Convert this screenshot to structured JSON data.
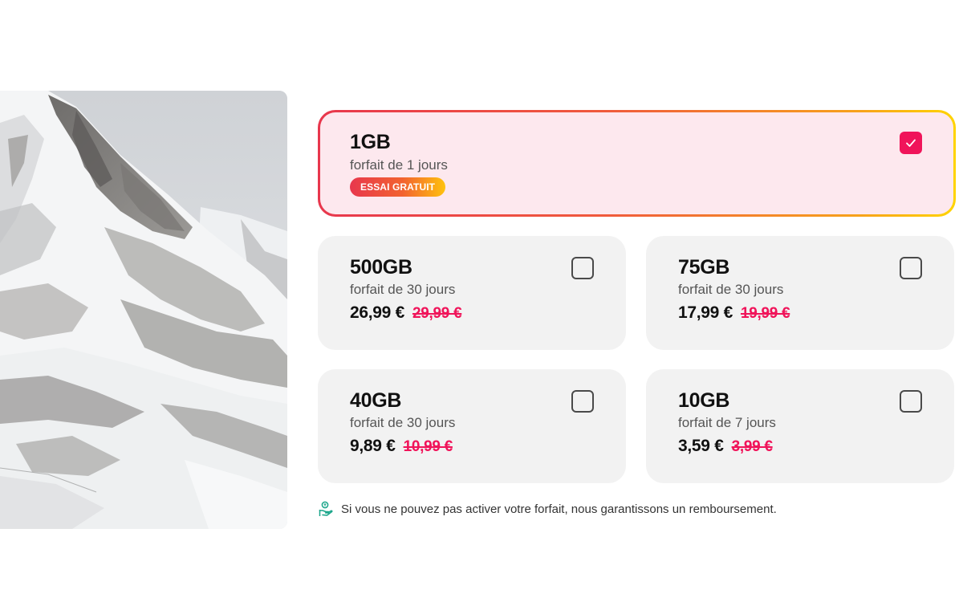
{
  "plans": {
    "featured": {
      "size": "1GB",
      "duration": "forfait de 1 jours",
      "badge": "ESSAI GRATUIT",
      "selected": true
    },
    "items": [
      {
        "size": "500GB",
        "duration": "forfait de 30 jours",
        "price": "26,99 €",
        "old_price": "29,99 €",
        "selected": false
      },
      {
        "size": "75GB",
        "duration": "forfait de 30 jours",
        "price": "17,99 €",
        "old_price": "19,99 €",
        "selected": false
      },
      {
        "size": "40GB",
        "duration": "forfait de 30 jours",
        "price": "9,89 €",
        "old_price": "10,99 €",
        "selected": false
      },
      {
        "size": "10GB",
        "duration": "forfait de 7 jours",
        "price": "3,59 €",
        "old_price": "3,99 €",
        "selected": false
      }
    ]
  },
  "note": {
    "icon": "money-back-hand-icon",
    "text": "Si vous ne pouvez pas activer votre forfait, nous garantissons un remboursement."
  },
  "hero": {
    "icon": "mountain-image"
  },
  "colors": {
    "accent": "#f0145a",
    "featured_bg": "#fde8ee",
    "card_bg": "#f2f2f2",
    "gradient_start": "#e8374d",
    "gradient_end": "#ffd400",
    "note_icon": "#1aa58a"
  }
}
